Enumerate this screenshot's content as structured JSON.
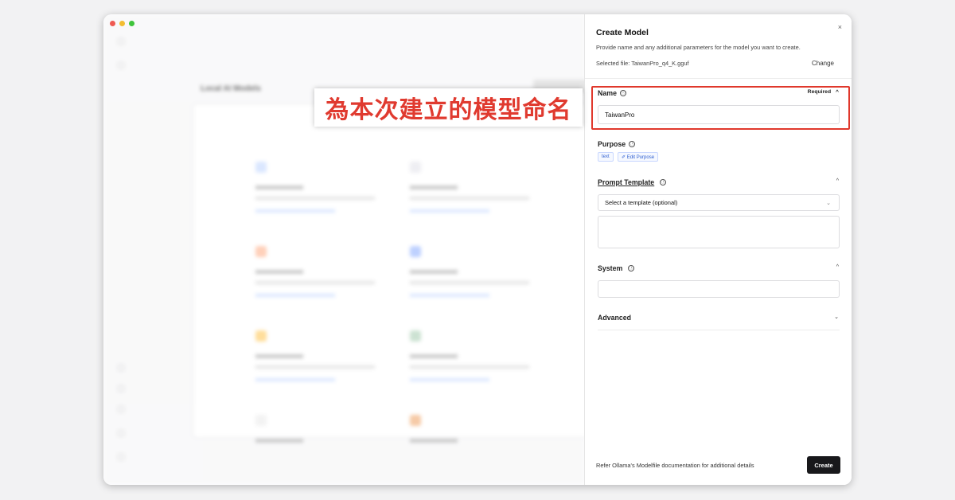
{
  "annotation": {
    "text": "為本次建立的模型命名"
  },
  "background": {
    "title": "Local AI Models"
  },
  "dialog": {
    "title": "Create Model",
    "close_icon": "×",
    "description": "Provide name and any additional parameters for the model you want to create.",
    "selected_file": "Selected file: TaiwanPro_q4_K.gguf",
    "change_label": "Change",
    "name": {
      "label": "Name",
      "info_icon": "ⓘ",
      "required_label": "Required",
      "chevron": "^",
      "value": "TaiwanPro"
    },
    "purpose": {
      "label": "Purpose",
      "info_icon": "ⓘ",
      "tags": [
        "text",
        "✐ Edit Purpose"
      ]
    },
    "prompt_template": {
      "label": "Prompt Template",
      "info_icon": "ⓘ",
      "chevron": "^",
      "select_value": "Select a template (optional)",
      "select_chevron": "⌄",
      "text_value": ""
    },
    "system": {
      "label": "System",
      "info_icon": "ⓘ",
      "chevron": "^",
      "value": ""
    },
    "advanced": {
      "label": "Advanced",
      "chevron": "⌄"
    },
    "footer_note": "Refer Ollama's Modelfile documentation for additional details",
    "create_label": "Create"
  },
  "colors": {
    "annotation_red": "#e0382c",
    "primary_button": "#18181b",
    "tag_blue": "#2f5fd0"
  }
}
